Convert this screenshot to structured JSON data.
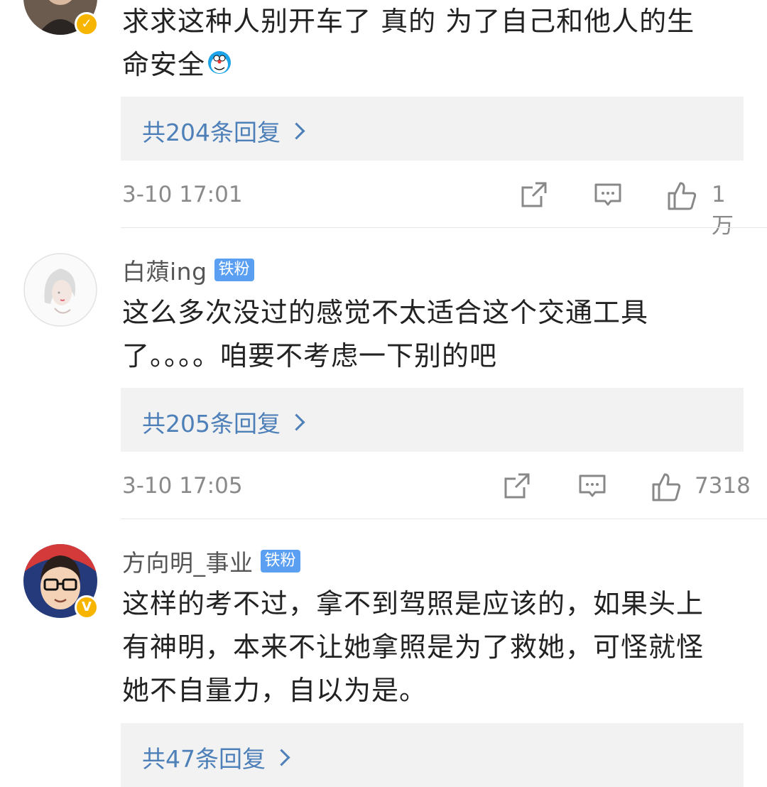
{
  "comments": [
    {
      "text_lines": [
        "求求这种人别开车了 真的 为了自己和他人的生",
        "命安全"
      ],
      "emoji": "doraemon-emoji",
      "replies_label": "共204条回复",
      "time": "3-10 17:01",
      "likes": "1万",
      "avatar_icon": "user-avatar-woman-photo",
      "verified": true
    },
    {
      "username": "白薠ing",
      "fan_badge": "铁粉",
      "text_lines": [
        "这么多次没过的感觉不太适合这个交通工具",
        "了。。。。咱要不考虑一下别的吧"
      ],
      "replies_label": "共205条回复",
      "time": "3-10 17:05",
      "likes": "7318",
      "avatar_icon": "user-avatar-sketch-girl",
      "verified": false
    },
    {
      "username": "方向明_事业",
      "fan_badge": "铁粉",
      "text_lines": [
        "这样的考不过，拿不到驾照是应该的，如果头上",
        "有神明，本来不让她拿照是为了救她，可怪就怪",
        "她不自量力，自以为是。"
      ],
      "replies_label": "共47条回复",
      "avatar_icon": "user-avatar-cartoon-man-glasses",
      "verified": true,
      "verified_badge": "V"
    }
  ],
  "icons": {
    "share": "share-icon",
    "comment": "comment-icon",
    "like": "thumbs-up-icon"
  },
  "colors": {
    "reply_link": "#4d7fb8",
    "fan_badge": "#5a9ff2",
    "verified_badge": "#f7b500",
    "reply_bg": "#f2f2f2"
  }
}
